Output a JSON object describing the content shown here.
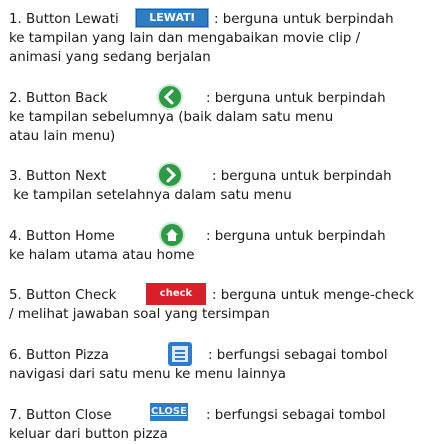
{
  "items": [
    {
      "label": "1. Button Lewati",
      "button_text": "LEWATI",
      "desc_line1": ": berguna untuk berpindah",
      "desc_line2": "ke tampilan yang lain dan mengabaikan movie clip /",
      "desc_line3": "animasi yang sedang berjalan"
    },
    {
      "label": "2. Button Back",
      "desc_line1": ": berguna untuk berpindah",
      "desc_line2": "ke tampilan sebelumnya (baik dalam satu menu",
      "desc_line3": "atau lain menu)"
    },
    {
      "label": "3. Button Next",
      "desc_line1": ": berguna untuk berpindah",
      "desc_line2": " ke tampilan setelahnya dalam satu menu"
    },
    {
      "label": "4. Button Home",
      "desc_line1": ": berguna untuk berpindah",
      "desc_line2": "ke halam utama atau home"
    },
    {
      "label": "5. Button Check",
      "button_text": "check",
      "desc_line1": ": berguna untuk menge-check",
      "desc_line2": "/ melihat jawaban soal yang tersimpan"
    },
    {
      "label": "6. Button Pizza",
      "desc_line1": ": berfungsi sebagai tombol",
      "desc_line2": "navigasi dari satu menu ke menu lainnya"
    },
    {
      "label": "7. Button Close",
      "button_text": "CLOSE",
      "desc_line1": ": berfungsi sebagai tombol",
      "desc_line2": "keluar dari button pizza"
    }
  ],
  "icons": {
    "back": "back-arrow-icon",
    "next": "next-arrow-icon",
    "home": "home-icon",
    "pizza": "pizza-menu-icon"
  },
  "colors": {
    "button_blue": "#2e7cc4",
    "icon_green": "#2d9a46",
    "check_red": "#d8202a",
    "pizza_blue": "#2f7bd0"
  }
}
